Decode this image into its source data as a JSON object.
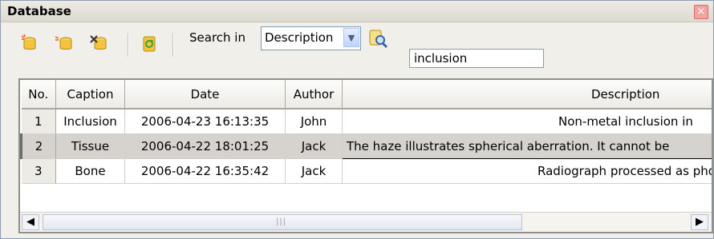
{
  "window": {
    "title": "Database"
  },
  "toolbar": {
    "buttons": [
      {
        "icon": "new-record-icon"
      },
      {
        "icon": "insert-record-icon"
      },
      {
        "icon": "delete-record-icon"
      },
      {
        "icon": "refresh-icon"
      }
    ],
    "search_label": "Search in",
    "search_field": "Description",
    "search_query": "inclusion"
  },
  "table": {
    "columns": [
      "No.",
      "Caption",
      "Date",
      "Author",
      "Description"
    ],
    "rows": [
      {
        "no": "1",
        "caption": "Inclusion",
        "date": "2006-04-23 16:13:35",
        "author": "John",
        "description": "Non-metal inclusion in"
      },
      {
        "no": "2",
        "caption": "Tissue",
        "date": "2006-04-22 18:01:25",
        "author": "Jack",
        "description": "The haze illustrates spherical aberration. It cannot be"
      },
      {
        "no": "3",
        "caption": "Bone",
        "date": "2006-04-22 16:35:42",
        "author": "Jack",
        "description": "Radiograph processed as pho"
      }
    ],
    "selected_row": 2
  },
  "colors": {
    "selection": "#d6d3ce",
    "border": "#7f9db9"
  }
}
